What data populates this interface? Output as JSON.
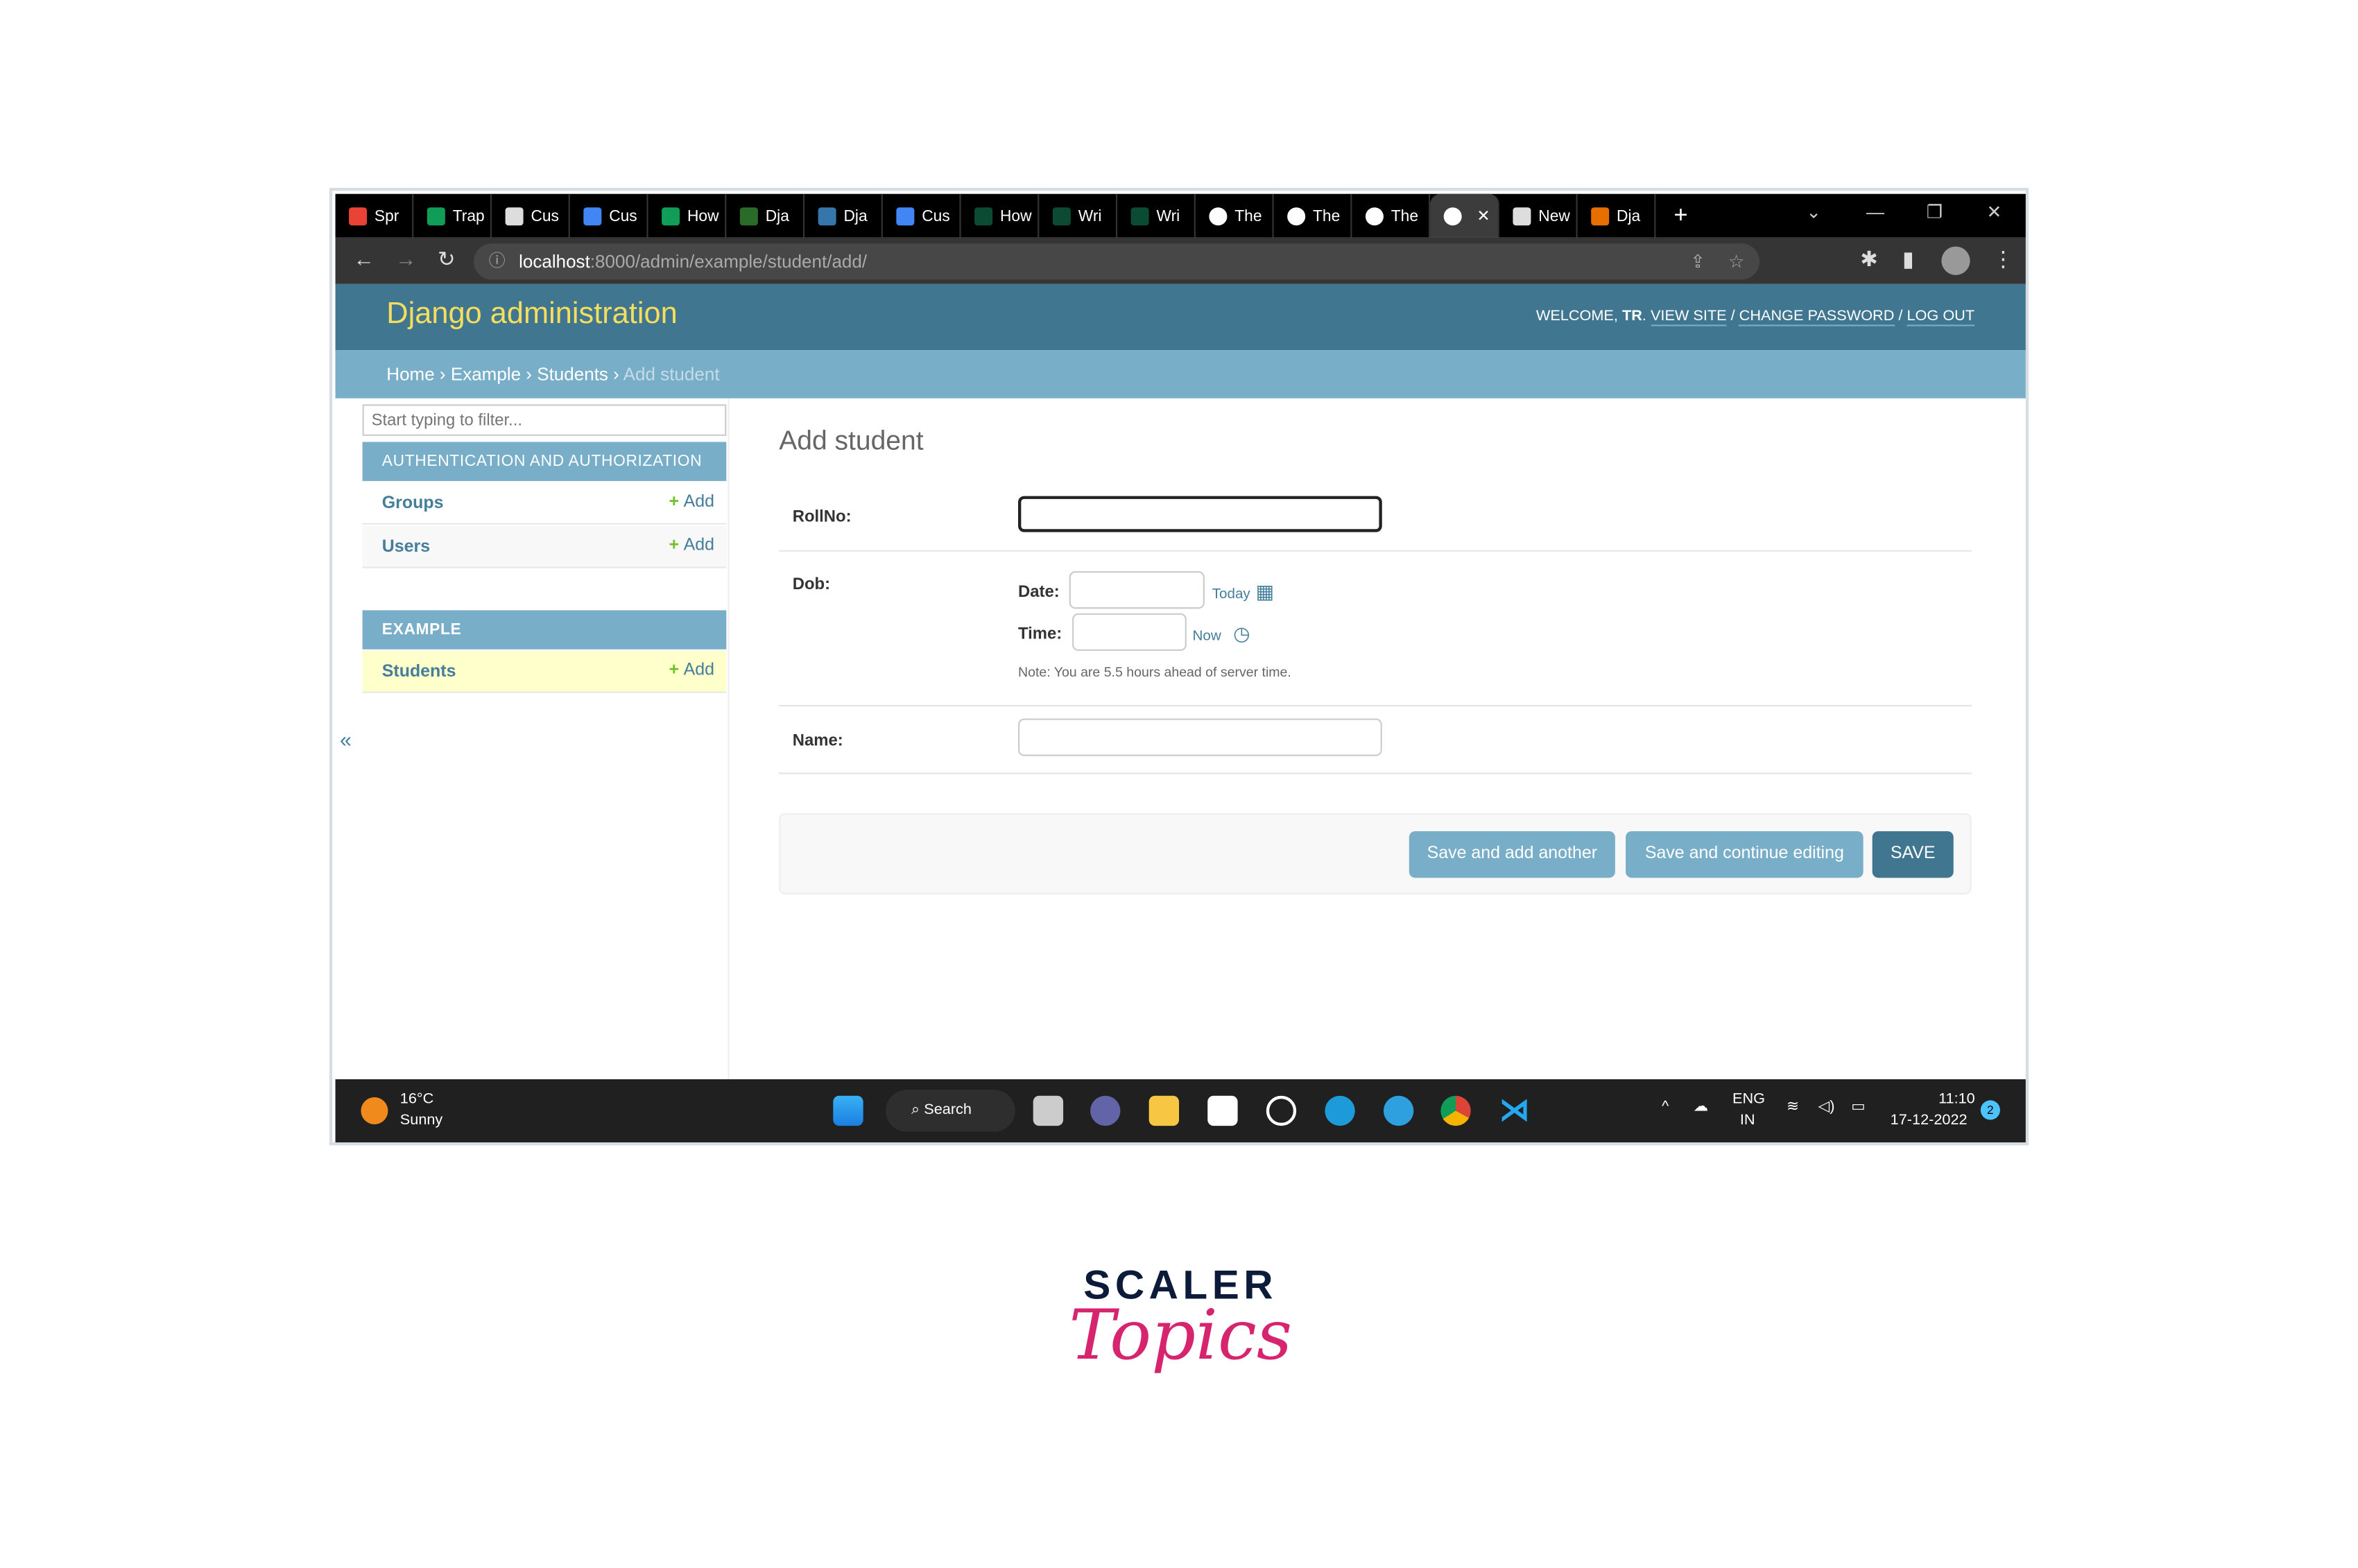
{
  "browser": {
    "tabs": [
      {
        "label": "Spr",
        "icon": "gmail-icon"
      },
      {
        "label": "Trap",
        "icon": "sheets-icon"
      },
      {
        "label": "Cus",
        "icon": "document-icon"
      },
      {
        "label": "Cus",
        "icon": "docs-icon"
      },
      {
        "label": "How",
        "icon": "green-icon"
      },
      {
        "label": "Dja",
        "icon": "django-icon"
      },
      {
        "label": "Dja",
        "icon": "python-icon"
      },
      {
        "label": "Cus",
        "icon": "docs-icon"
      },
      {
        "label": "How",
        "icon": "dj-icon"
      },
      {
        "label": "Wri",
        "icon": "dj-icon"
      },
      {
        "label": "Wri",
        "icon": "dj-icon"
      },
      {
        "label": "The",
        "icon": "globe-icon"
      },
      {
        "label": "The",
        "icon": "globe-icon"
      },
      {
        "label": "The",
        "icon": "globe-icon"
      },
      {
        "label": "",
        "icon": "globe-icon",
        "active": true
      },
      {
        "label": "New",
        "icon": "chrome-icon"
      },
      {
        "label": "Dja",
        "icon": "java-icon"
      }
    ],
    "url_host": "localhost",
    "url_path": ":8000/admin/example/student/add/"
  },
  "header": {
    "brand": "Django administration",
    "welcome": "Welcome,",
    "user": "TR",
    "view_site": "View site",
    "change_password": "Change password",
    "log_out": "Log out"
  },
  "breadcrumbs": {
    "home": "Home",
    "app": "Example",
    "model": "Students",
    "current": "Add student"
  },
  "sidebar": {
    "filter_placeholder": "Start typing to filter...",
    "modules": [
      {
        "title": "Authentication and Authorization",
        "items": [
          {
            "label": "Groups",
            "add": "Add"
          },
          {
            "label": "Users",
            "add": "Add"
          }
        ]
      },
      {
        "title": "Example",
        "items": [
          {
            "label": "Students",
            "add": "Add",
            "selected": true
          }
        ]
      }
    ],
    "collapse": "«"
  },
  "form": {
    "title": "Add student",
    "rollno_label": "RollNo:",
    "rollno_value": "",
    "dob_label": "Dob:",
    "date_label": "Date:",
    "date_value": "",
    "today": "Today",
    "time_label": "Time:",
    "time_value": "",
    "now": "Now",
    "note": "Note: You are 5.5 hours ahead of server time.",
    "name_label": "Name:",
    "name_value": "",
    "save_add_another": "Save and add another",
    "save_continue": "Save and continue editing",
    "save": "SAVE"
  },
  "taskbar": {
    "temperature": "16°C",
    "weather": "Sunny",
    "search": "Search",
    "lang1": "ENG",
    "lang2": "IN",
    "time": "11:10",
    "date": "17-12-2022",
    "notifications": "2"
  },
  "logo": {
    "line1": "SCALER",
    "line2": "Topics"
  },
  "colors": {
    "header": "#417690",
    "breadcrumb": "#79aec8",
    "brand": "#f5dd5d",
    "link": "#447e9b",
    "selected": "#ffffcc",
    "add_plus": "#70bf2b"
  }
}
